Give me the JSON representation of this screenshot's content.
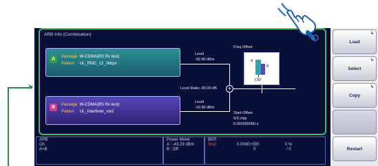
{
  "arb_info": {
    "title": "ARB Info (Combination)",
    "package_key": "Package",
    "pattern_key": "Pattern",
    "pkg_a": {
      "badge": "A",
      "package": "W-CDMA(BS Rx test)",
      "pattern": "UL_RMC_12_2kbps"
    },
    "pkg_b": {
      "badge": "B",
      "package": "W-CDMA(BS Rx test)",
      "pattern": "UL_Interferer_cw2"
    },
    "level_a": {
      "label": "Level",
      "value": "-92.90 dBm"
    },
    "level_b": {
      "label": "Level",
      "value": "-10.90 dBm"
    },
    "level_ratio": "Level Ratio  -83.00 dB",
    "freq_offset": {
      "label": "Freq Offset",
      "a_label": "A",
      "b_label": "B",
      "cnt_label": "CNT"
    },
    "start_offset": {
      "label": "Start Offset",
      "chip": "0/3 chip",
      "seconds": "0.000000000 s"
    },
    "combiner_symbol": "+"
  },
  "status": {
    "arb": {
      "title": "ARB",
      "line1": "On",
      "line2": "A+B"
    },
    "power_meter": {
      "title": "Power Meter",
      "a_label": "A",
      "a_value": ": -43.29 dBm",
      "b_label": "B",
      "b_value": ": Off"
    },
    "ber": {
      "title": "BER",
      "state": "Stop",
      "rate": "0.000E+000",
      "percent": "0  %",
      "count_left": "0",
      "count_right": "/ 0"
    }
  },
  "softkeys": {
    "load": "Load",
    "select": "Select",
    "copy": "Copy",
    "restart": "Restart",
    "submenu_mark": "↳"
  },
  "colors": {
    "highlight": "#3dc16a",
    "screen_bg": "#0a0f3a",
    "package_a": "#2e8f90",
    "package_b": "#5a46b8"
  }
}
